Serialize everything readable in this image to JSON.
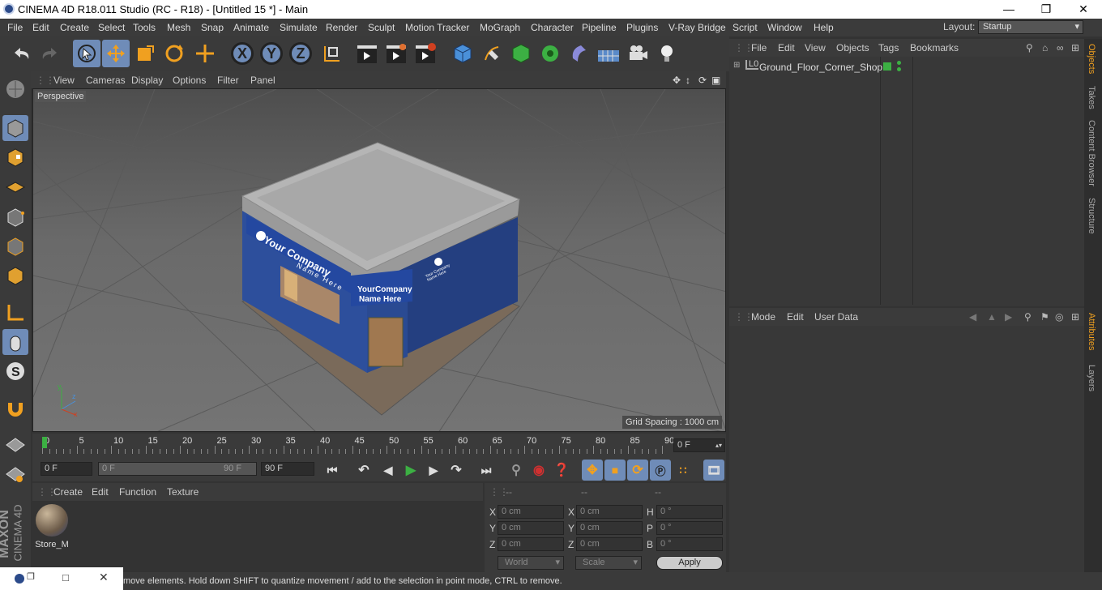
{
  "window": {
    "title": "CINEMA 4D R18.011 Studio (RC - R18) - [Untitled 15 *] - Main"
  },
  "menu": {
    "items": [
      "File",
      "Edit",
      "Create",
      "Select",
      "Tools",
      "Mesh",
      "Snap",
      "Animate",
      "Simulate",
      "Render",
      "Sculpt",
      "Motion Tracker",
      "MoGraph",
      "Character",
      "Pipeline",
      "Plugins",
      "V-Ray Bridge",
      "Script",
      "Window",
      "Help"
    ],
    "layout_label": "Layout:",
    "layout_value": "Startup"
  },
  "toolbar": {
    "axis_x": "X",
    "axis_y": "Y",
    "axis_z": "Z"
  },
  "viewport": {
    "menu": [
      "View",
      "Cameras",
      "Display",
      "Options",
      "Filter",
      "Panel"
    ],
    "camera_label": "Perspective",
    "grid_spacing": "Grid Spacing : 1000 cm",
    "sign_main_1": "Your Company",
    "sign_main_2": "Name Here",
    "sign_small_1": "YourCompany",
    "sign_small_2": "Name Here",
    "sign_tiny": "Your Company Name Here"
  },
  "timeline": {
    "ticks": [
      "0",
      "5",
      "10",
      "15",
      "20",
      "25",
      "30",
      "35",
      "40",
      "45",
      "50",
      "55",
      "60",
      "65",
      "70",
      "75",
      "80",
      "85",
      "90"
    ],
    "current_frame": "0 F"
  },
  "transport": {
    "start": "0 F",
    "range_start": "0 F",
    "range_end": "90 F",
    "end": "90 F"
  },
  "materials": {
    "menu": [
      "Create",
      "Edit",
      "Function",
      "Texture"
    ],
    "items": [
      {
        "name": "Store_M"
      }
    ]
  },
  "coords": {
    "headers": [
      "--",
      "--",
      "--"
    ],
    "rows": [
      {
        "a_label": "X",
        "a_val": "0 cm",
        "b_label": "X",
        "b_val": "0 cm",
        "c_label": "H",
        "c_val": "0 °"
      },
      {
        "a_label": "Y",
        "a_val": "0 cm",
        "b_label": "Y",
        "b_val": "0 cm",
        "c_label": "P",
        "c_val": "0 °"
      },
      {
        "a_label": "Z",
        "a_val": "0 cm",
        "b_label": "Z",
        "b_val": "0 cm",
        "c_label": "B",
        "c_val": "0 °"
      }
    ],
    "world": "World",
    "scale": "Scale",
    "apply": "Apply"
  },
  "objects": {
    "menu": [
      "File",
      "Edit",
      "View",
      "Objects",
      "Tags",
      "Bookmarks"
    ],
    "items": [
      {
        "name": "Ground_Floor_Corner_Shop",
        "layer": "L0"
      }
    ]
  },
  "attributes": {
    "menu": [
      "Mode",
      "Edit",
      "User Data"
    ]
  },
  "side_tabs": {
    "top": [
      "Objects",
      "Takes",
      "Content Browser",
      "Structure"
    ],
    "bottom": [
      "Attributes",
      "Layers"
    ]
  },
  "branding": {
    "maxon": "MAXON",
    "cinema": "CINEMA 4D"
  },
  "status": {
    "text": "move elements. Hold down SHIFT to quantize movement / add to the selection in point mode, CTRL to remove."
  },
  "colors": {
    "accent": "#6f8cb8",
    "shop_blue": "#2d4f9c",
    "ui_bg": "#333333"
  }
}
